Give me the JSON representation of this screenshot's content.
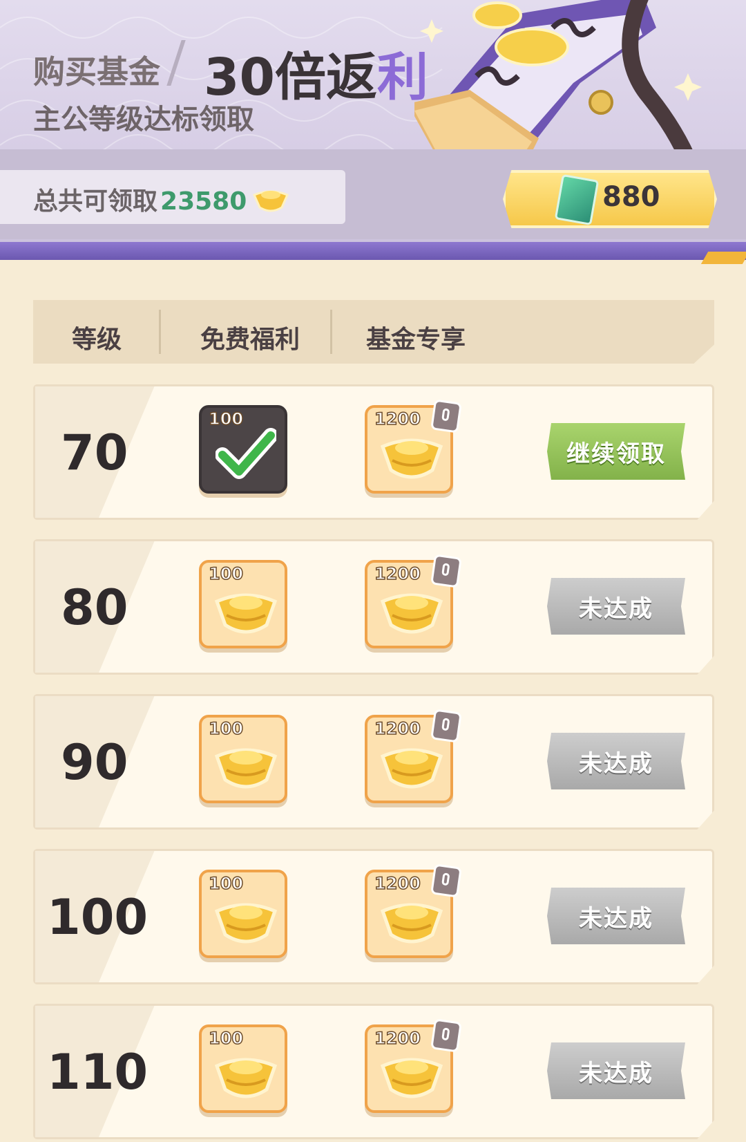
{
  "header": {
    "title_prefix": "购买基金",
    "title_main": "30倍返",
    "title_accent": "利",
    "subtitle": "主公等级达标领取",
    "total_label": "总共可领取",
    "total_value": "23580",
    "cost": "880",
    "colors": {
      "accent": "#8c6bd6",
      "total_value": "#3e9a6c",
      "purple_bar": "#7a65c0"
    }
  },
  "table": {
    "columns": [
      "等级",
      "免费福利",
      "基金专享"
    ],
    "rows": [
      {
        "level": "70",
        "free_amount": "100",
        "free_claimed": true,
        "fund_amount": "1200",
        "fund_locked": true,
        "action": "继续领取",
        "action_style": "green"
      },
      {
        "level": "80",
        "free_amount": "100",
        "free_claimed": false,
        "fund_amount": "1200",
        "fund_locked": true,
        "action": "未达成",
        "action_style": "gray"
      },
      {
        "level": "90",
        "free_amount": "100",
        "free_claimed": false,
        "fund_amount": "1200",
        "fund_locked": true,
        "action": "未达成",
        "action_style": "gray"
      },
      {
        "level": "100",
        "free_amount": "100",
        "free_claimed": false,
        "fund_amount": "1200",
        "fund_locked": true,
        "action": "未达成",
        "action_style": "gray"
      },
      {
        "level": "110",
        "free_amount": "100",
        "free_claimed": false,
        "fund_amount": "1200",
        "fund_locked": true,
        "action": "未达成",
        "action_style": "gray"
      }
    ]
  },
  "icons": {
    "currency": "gold-ingot-icon",
    "cost": "jade-book-icon",
    "claimed": "checkmark-icon",
    "locked": "lock-icon"
  }
}
